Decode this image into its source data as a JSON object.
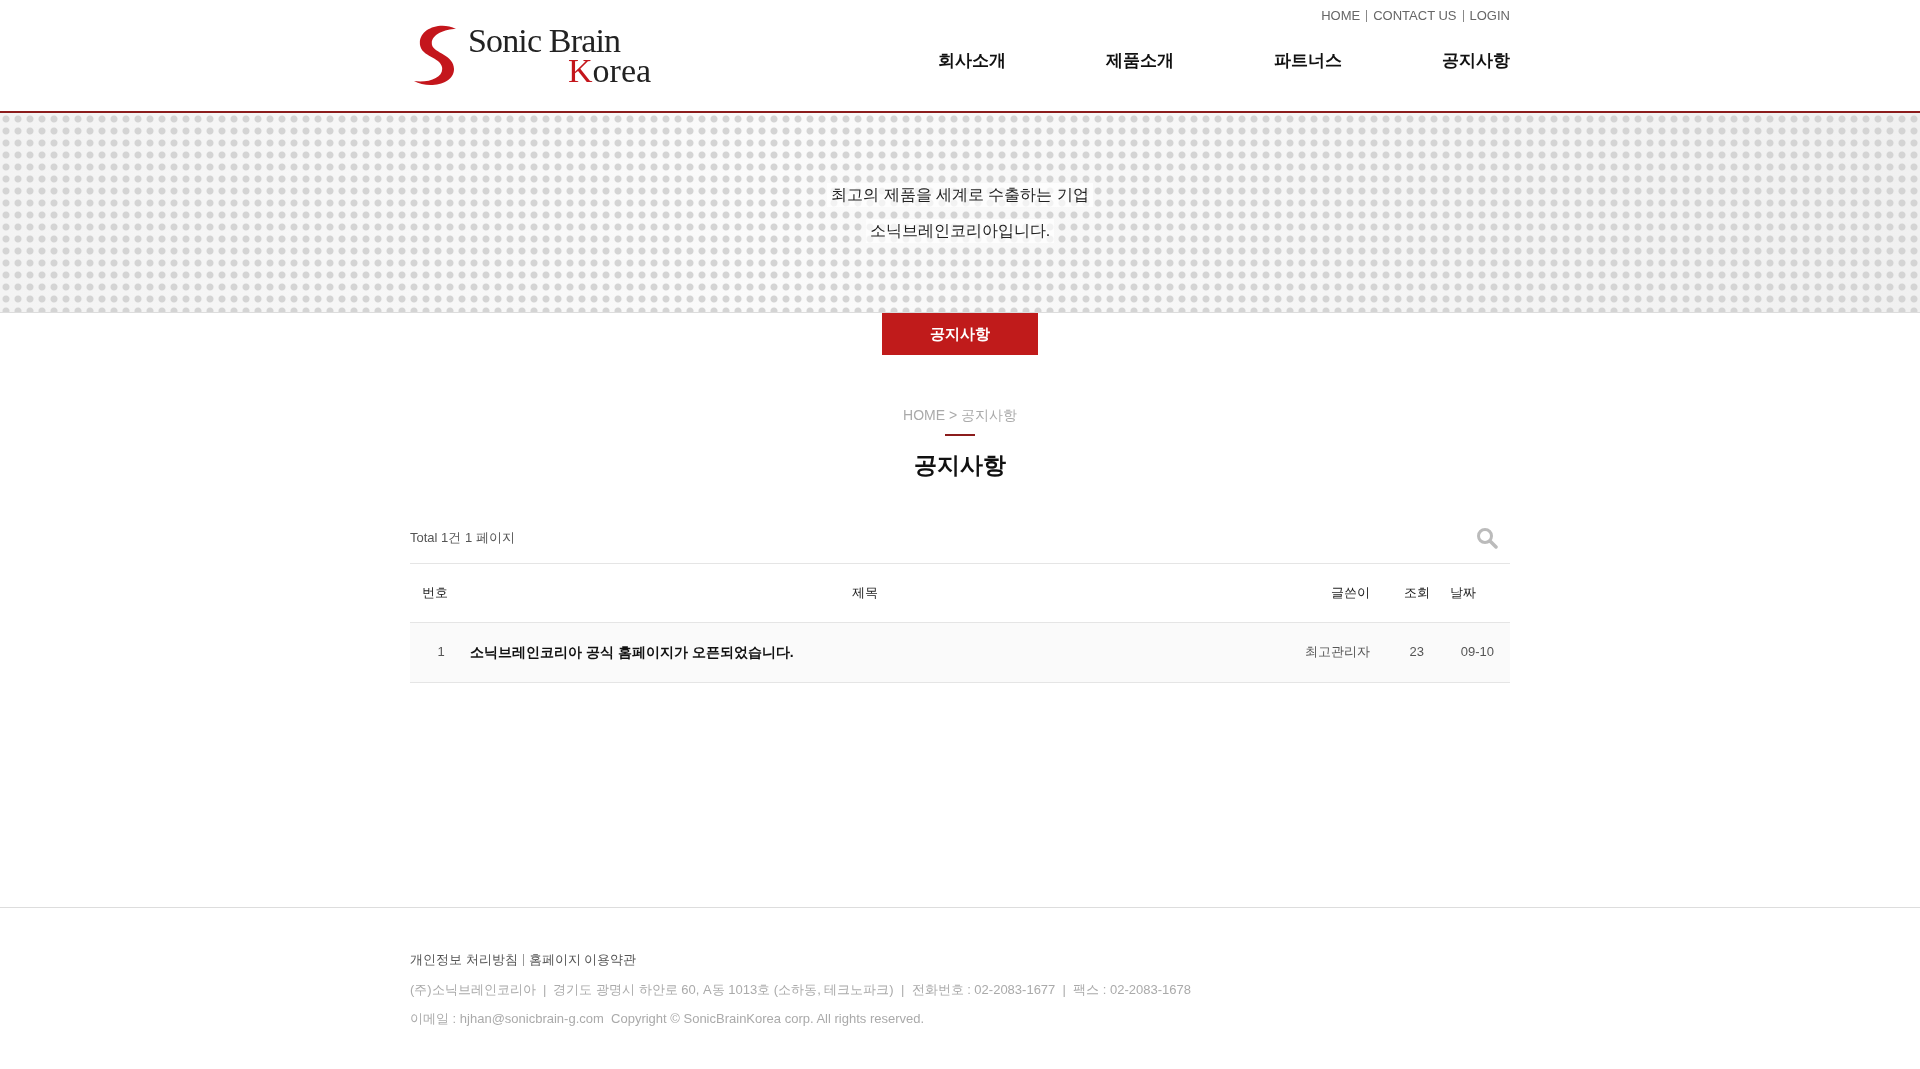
{
  "header": {
    "logo": {
      "line1": "Sonic Brain",
      "initial": "K",
      "rest": "orea"
    },
    "top_links": [
      "HOME",
      "CONTACT US",
      "LOGIN"
    ],
    "nav": [
      "회사소개",
      "제품소개",
      "파트너스",
      "공지사항"
    ]
  },
  "banner": {
    "lines": [
      "최고의 제품을 세계로 수출하는 기업",
      "소닉브레인코리아입니다."
    ]
  },
  "sub_tab": "공지사항",
  "breadcrumb": "HOME > 공지사항",
  "page_title": "공지사항",
  "board": {
    "total": "Total 1건 1 페이지",
    "columns": [
      "번호",
      "제목",
      "글쓴이",
      "조회",
      "날짜"
    ],
    "rows": [
      {
        "number": "1",
        "title": "소닉브레인코리아 공식 홈페이지가 오픈되었습니다.",
        "author": "최고관리자",
        "views": "23",
        "date": "09-10"
      }
    ]
  },
  "footer": {
    "links": [
      "개인정보 처리방침",
      "홈페이지 이용약관"
    ],
    "address": "(주)소닉브레인코리아  |  경기도 광명시 하안로 60, A동 1013호 (소하동, 테크노파크)  |  전화번호 : 02-2083-1677  |  팩스 : 02-2083-1678",
    "contact": "이메일 : hjhan@sonicbrain-g.com  Copyright © SonicBrainKorea corp. All rights reserved."
  }
}
